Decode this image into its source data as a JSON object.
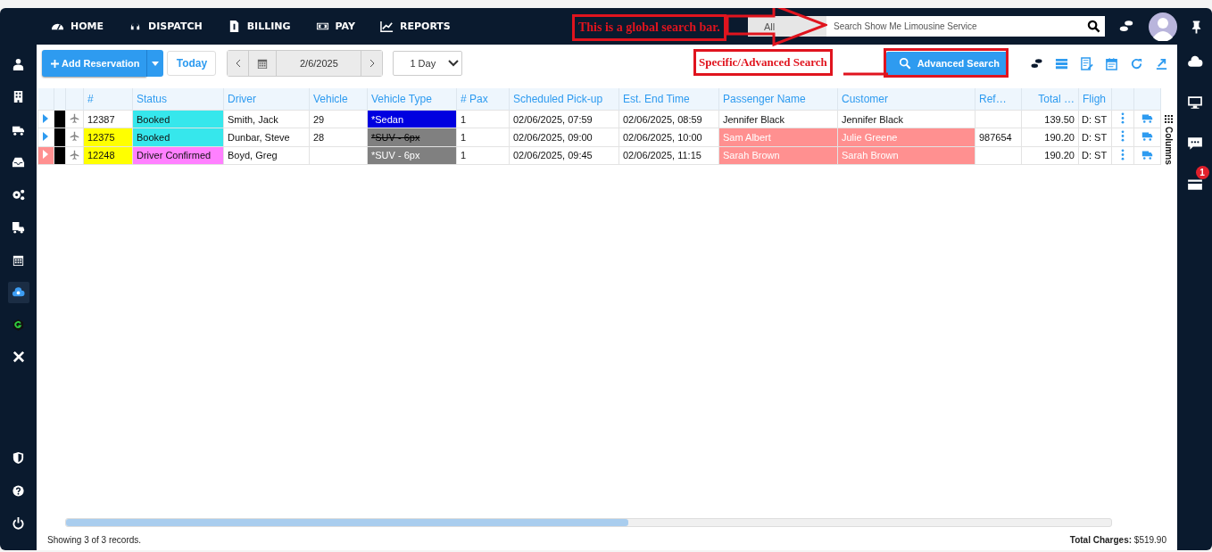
{
  "nav": {
    "items": [
      {
        "label": "HOME"
      },
      {
        "label": "DISPATCH"
      },
      {
        "label": "BILLING"
      },
      {
        "label": "PAY"
      },
      {
        "label": "REPORTS"
      }
    ]
  },
  "search": {
    "scope": "All",
    "placeholder": "Search Show Me Limousine Service"
  },
  "annotations": {
    "global": "This is a global search bar.",
    "specific": "Specific/Advanced Search"
  },
  "sidebar": {
    "items": [
      {
        "selected": false
      },
      {
        "selected": false
      },
      {
        "selected": false
      },
      {
        "selected": false
      },
      {
        "selected": false
      },
      {
        "selected": false
      },
      {
        "selected": false
      },
      {
        "selected": true
      },
      {
        "selected": false
      },
      {
        "selected": false
      },
      {
        "selected": false
      },
      {
        "selected": false
      },
      {
        "selected": false
      }
    ]
  },
  "right_sidebar": {
    "badge": "1"
  },
  "toolbar": {
    "add": "Add Reservation",
    "today": "Today",
    "date": "2/6/2025",
    "range": "1 Day",
    "advanced": "Advanced Search"
  },
  "table": {
    "columns": [
      "#",
      "Status",
      "Driver",
      "Vehicle",
      "Vehicle Type",
      "# Pax",
      "Scheduled Pick-up",
      "Est. End Time",
      "Passenger Name",
      "Customer",
      "Ref…",
      "Total …",
      "Fligh"
    ],
    "rows": [
      {
        "flagged": false,
        "number": {
          "text": "12387",
          "color": "#ffffff"
        },
        "status": {
          "text": "Booked",
          "color": "#36e7ec"
        },
        "driver": "Smith, Jack",
        "vehicle": "29",
        "vehicle_type": {
          "text": "*Sedan",
          "color": "#0000e0",
          "strikethrough": false
        },
        "pax": "1",
        "pickup": "02/06/2025, 07:59",
        "end": "02/06/2025, 08:59",
        "passenger": {
          "text": "Jennifer Black",
          "highlight": false
        },
        "customer": {
          "text": "Jennifer Black",
          "highlight": false
        },
        "ref": "",
        "total": "139.50",
        "flight": "D: ST"
      },
      {
        "flagged": false,
        "number": {
          "text": "12375",
          "color": "#ffff00"
        },
        "status": {
          "text": "Booked",
          "color": "#36e7ec"
        },
        "driver": "Dunbar, Steve",
        "vehicle": "28",
        "vehicle_type": {
          "text": "*SUV - 6px",
          "color": "#808080",
          "strikethrough": true
        },
        "pax": "1",
        "pickup": "02/06/2025, 09:00",
        "end": "02/06/2025, 10:00",
        "passenger": {
          "text": "Sam Albert",
          "highlight": true
        },
        "customer": {
          "text": "Julie Greene",
          "highlight": true
        },
        "ref": "987654",
        "total": "190.20",
        "flight": "D: ST"
      },
      {
        "flagged": true,
        "number": {
          "text": "12248",
          "color": "#ffff00"
        },
        "status": {
          "text": "Driver Confirmed",
          "color": "#ff80ff"
        },
        "driver": "Boyd, Greg",
        "vehicle": "",
        "vehicle_type": {
          "text": "*SUV - 6px",
          "color": "#808080",
          "strikethrough": false
        },
        "pax": "1",
        "pickup": "02/06/2025, 09:45",
        "end": "02/06/2025, 11:15",
        "passenger": {
          "text": "Sarah Brown",
          "highlight": true
        },
        "customer": {
          "text": "Sarah Brown",
          "highlight": true
        },
        "ref": "",
        "total": "190.20",
        "flight": "D: ST"
      }
    ]
  },
  "columns_tab": "Columns",
  "footer": {
    "records": "Showing 3 of 3 records.",
    "total_label": "Total Charges:",
    "total_value": "$519.90"
  }
}
